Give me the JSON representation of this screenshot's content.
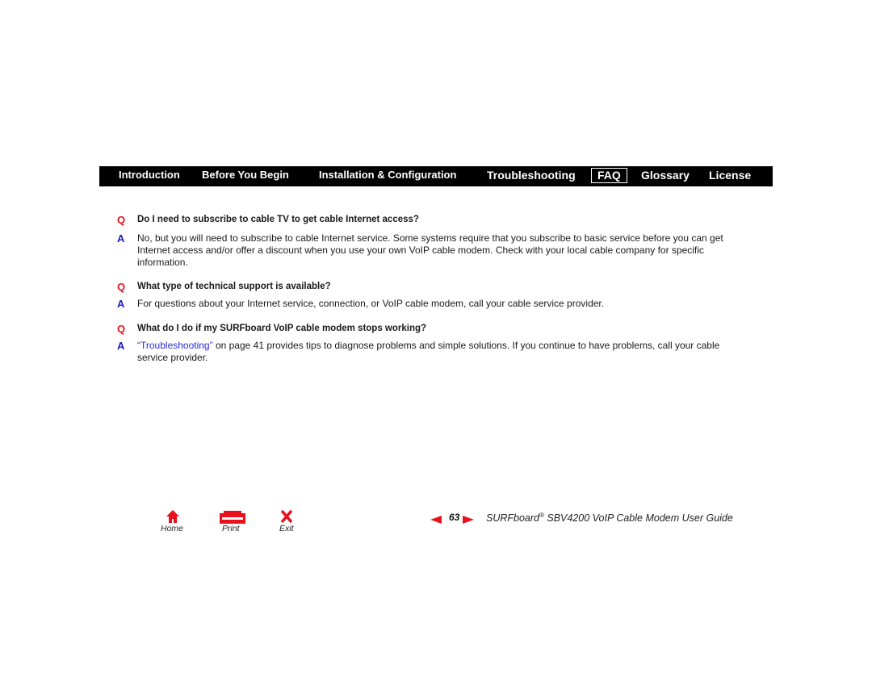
{
  "nav": {
    "items": [
      {
        "label": "Introduction"
      },
      {
        "label": "Before You Begin"
      },
      {
        "label": "Installation & Configuration"
      },
      {
        "label": "Troubleshooting"
      },
      {
        "label": "FAQ",
        "active": true
      },
      {
        "label": "Glossary"
      },
      {
        "label": "License"
      }
    ]
  },
  "faq": [
    {
      "q_mark": "Q",
      "question": "Do I need to subscribe to cable TV to get cable Internet access?",
      "a_mark": "A",
      "answer_lines": [
        "No, but you will need to subscribe to cable Internet service. Some systems require that you subscribe to basic service before you can get",
        "Internet access and/or offer a discount when you use your own VoIP cable modem. Check with your local cable company for specific",
        "information."
      ]
    },
    {
      "q_mark": "Q",
      "question": "What type of technical support is available?",
      "a_mark": "A",
      "answer_lines": [
        "For questions about your Internet service, connection, or VoIP cable modem, call your cable service provider."
      ]
    },
    {
      "q_mark": "Q",
      "question": "What do I do if my SURFboard VoIP cable modem stops working?",
      "a_mark": "A",
      "answer_link": "“Troubleshooting”",
      "answer_after_link": " on page 41 provides tips to diagnose problems and simple solutions. If you continue to have problems, call your cable",
      "answer_line2": "service provider."
    }
  ],
  "footer": {
    "home_label": "Home",
    "print_label": "Print",
    "exit_label": "Exit",
    "page_number": "63",
    "guide_brand": "SURFboard",
    "guide_reg": "®",
    "guide_rest": " SBV4200 VoIP Cable Modem User Guide"
  },
  "colors": {
    "accent_red": "#e8111c",
    "answer_blue": "#1a1ac8",
    "link_blue": "#2a2ad8",
    "nav_bg": "#000000"
  }
}
